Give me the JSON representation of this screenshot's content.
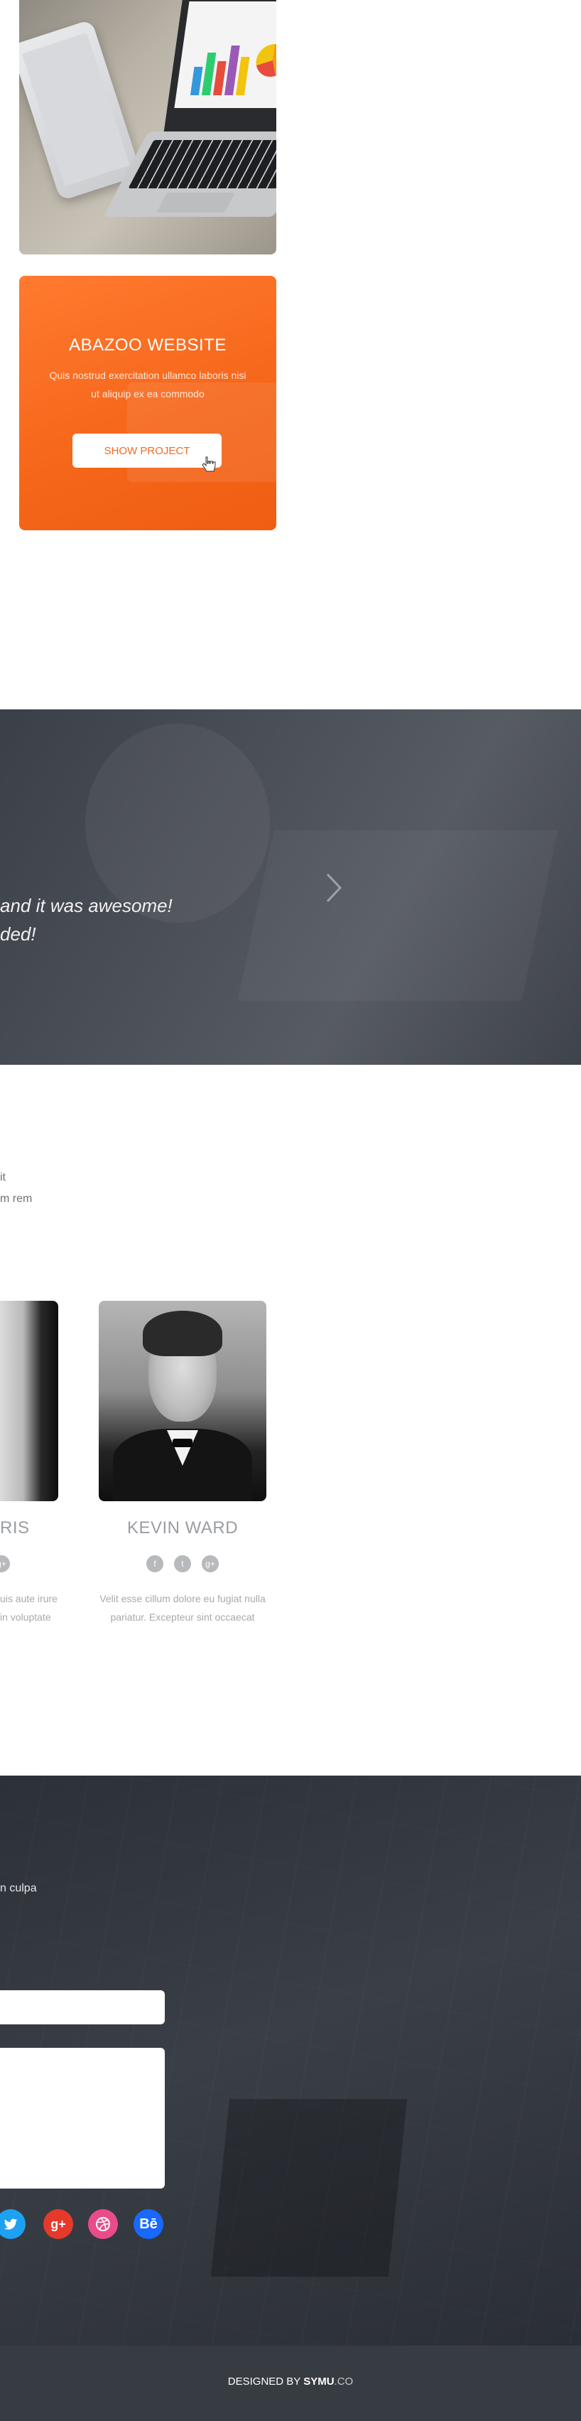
{
  "portfolio": {
    "card": {
      "title": "ABAZOO WEBSITE",
      "description": "Quis nostrud exercitation ullamco laboris nisi ut aliquip ex ea commodo",
      "button_label": "SHOW PROJECT"
    },
    "accent_color": "#f5661a"
  },
  "testimonial": {
    "quote_line1": "and it was awesome!",
    "quote_line2": "ded!",
    "next_icon": "chevron-right-icon"
  },
  "team": {
    "intro_line1": "it",
    "intro_line2": "m rem",
    "members": [
      {
        "name": "RIS",
        "bio_line1": "uis aute irure",
        "bio_line2": "in voluptate",
        "social": [
          "google-plus-icon"
        ]
      },
      {
        "name": "KEVIN WARD",
        "bio_line1": "Velit esse cillum dolore eu fugiat nulla",
        "bio_line2": "pariatur. Excepteur sint occaecat",
        "social": [
          "facebook-icon",
          "twitter-icon",
          "google-plus-icon"
        ]
      }
    ]
  },
  "contact": {
    "text": "n culpa",
    "social": [
      {
        "icon": "twitter-icon",
        "color": "#1da1f2"
      },
      {
        "icon": "google-plus-icon",
        "color": "#e5392c"
      },
      {
        "icon": "dribbble-icon",
        "color": "#ea4c89"
      },
      {
        "icon": "behance-icon",
        "color": "#1769ff"
      }
    ]
  },
  "footer": {
    "prefix": "DESIGNED BY ",
    "brand": "SYMU",
    "suffix": ".CO"
  }
}
